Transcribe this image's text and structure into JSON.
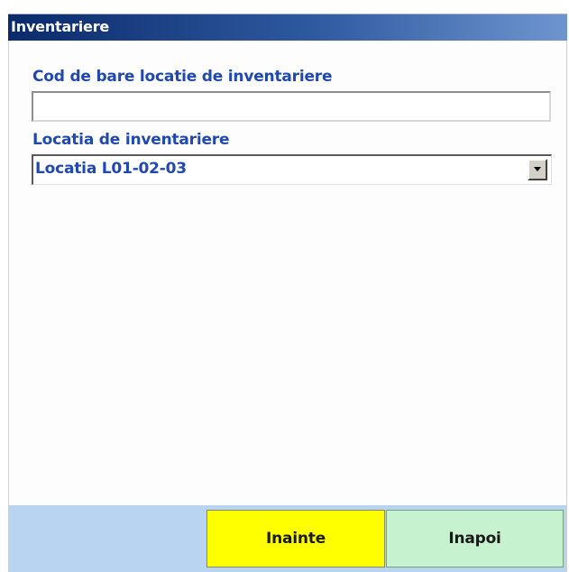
{
  "window": {
    "title": "Inventariere"
  },
  "form": {
    "barcode_label": "Cod de bare locatie de inventariere",
    "barcode_value": "",
    "location_label": "Locatia de inventariere",
    "location_selected": "Locatia L01-02-03"
  },
  "actions": {
    "next_label": "Inainte",
    "back_label": "Inapoi"
  },
  "colors": {
    "title_bar_start": "#0a2a6b",
    "title_bar_end": "#6e95cf",
    "label_text": "#1f49b0",
    "bottom_bar": "#b9d4f1",
    "next_button": "#ffff00",
    "back_button": "#c7f2cf"
  },
  "icons": {
    "dropdown": "chevron-down-icon"
  }
}
